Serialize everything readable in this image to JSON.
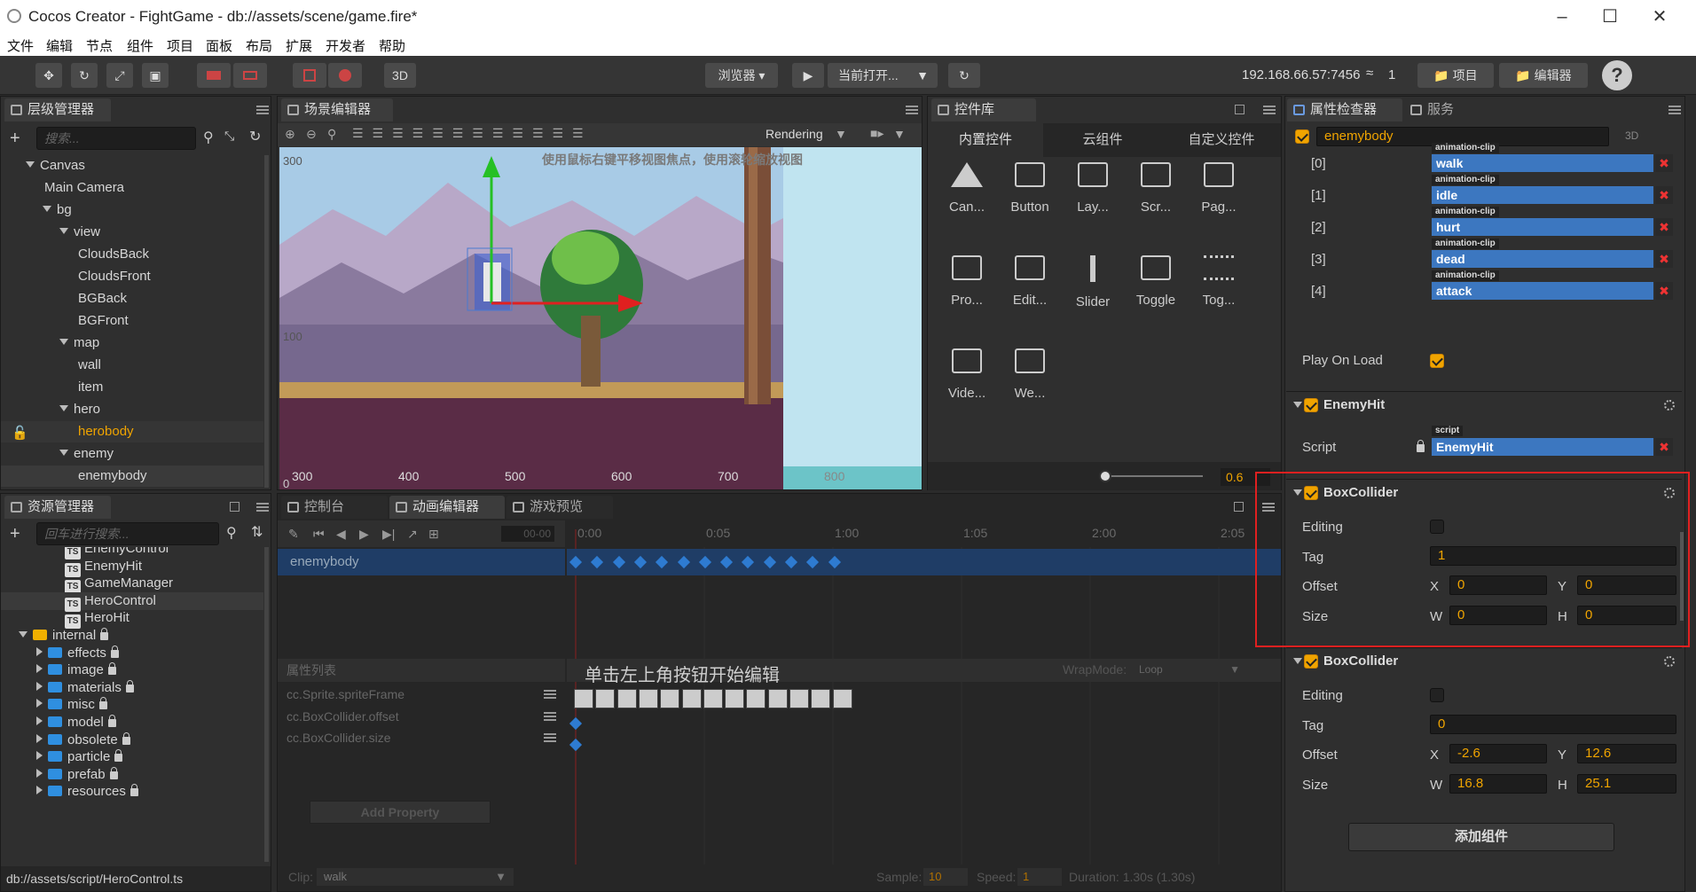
{
  "app": {
    "title": "Cocos Creator - FightGame - db://assets/scene/game.fire*"
  },
  "menu": [
    "文件",
    "编辑",
    "节点",
    "组件",
    "项目",
    "面板",
    "布局",
    "扩展",
    "开发者",
    "帮助"
  ],
  "toolbar": {
    "btn3d": "3D",
    "browser": "浏览器 ▾",
    "current": "当前打开...",
    "ip": "192.168.66.57:7456",
    "conn_count": "1",
    "project": "项目",
    "editor": "编辑器",
    "help": "?"
  },
  "hierarchy": {
    "title": "层级管理器",
    "search_placeholder": "搜索...",
    "nodes": [
      {
        "label": "Canvas",
        "level": 0,
        "arrow": "down"
      },
      {
        "label": "Main Camera",
        "level": 1,
        "arrow": ""
      },
      {
        "label": "bg",
        "level": 1,
        "arrow": "down"
      },
      {
        "label": "view",
        "level": 2,
        "arrow": "down"
      },
      {
        "label": "CloudsBack",
        "level": 3,
        "arrow": ""
      },
      {
        "label": "CloudsFront",
        "level": 3,
        "arrow": ""
      },
      {
        "label": "BGBack",
        "level": 3,
        "arrow": ""
      },
      {
        "label": "BGFront",
        "level": 3,
        "arrow": ""
      },
      {
        "label": "map",
        "level": 2,
        "arrow": "down"
      },
      {
        "label": "wall",
        "level": 3,
        "arrow": ""
      },
      {
        "label": "item",
        "level": 3,
        "arrow": ""
      },
      {
        "label": "hero",
        "level": 2,
        "arrow": "down"
      },
      {
        "label": "herobody",
        "level": 3,
        "arrow": "",
        "highlight": true
      },
      {
        "label": "enemy",
        "level": 2,
        "arrow": "down"
      },
      {
        "label": "enemybody",
        "level": 3,
        "arrow": "",
        "selected": true
      }
    ]
  },
  "scene": {
    "title": "场景编辑器",
    "rendering": "Rendering",
    "hint": "使用鼠标右键平移视图焦点，使用滚轮缩放视图",
    "y_labels": [
      "300",
      "100",
      "0"
    ],
    "x_labels": [
      "300",
      "400",
      "500",
      "600",
      "700",
      "800"
    ]
  },
  "widgets": {
    "title": "控件库",
    "tabs": [
      "内置控件",
      "云组件",
      "自定义控件"
    ],
    "items": [
      {
        "label": "Can...",
        "icon": "canvas-icon"
      },
      {
        "label": "Button",
        "icon": "button-icon"
      },
      {
        "label": "Lay...",
        "icon": "layout-icon"
      },
      {
        "label": "Scr...",
        "icon": "scrollview-icon"
      },
      {
        "label": "Pag...",
        "icon": "pageview-icon"
      },
      {
        "label": "Pro...",
        "icon": "progressbar-icon"
      },
      {
        "label": "Edit...",
        "icon": "editbox-icon"
      },
      {
        "label": "Slider",
        "icon": "slider-icon"
      },
      {
        "label": "Toggle",
        "icon": "toggle-icon"
      },
      {
        "label": "Tog...",
        "icon": "togglegroup-icon"
      },
      {
        "label": "Vide...",
        "icon": "videoplayer-icon"
      },
      {
        "label": "We...",
        "icon": "webview-icon"
      }
    ],
    "zoom": "0.6",
    "zoom_level": 0.0
  },
  "assets": {
    "title": "资源管理器",
    "search_placeholder": "回车进行搜索...",
    "items": [
      {
        "label": "EnemyControl",
        "type": "ts",
        "level": 3
      },
      {
        "label": "EnemyHit",
        "type": "ts",
        "level": 3
      },
      {
        "label": "GameManager",
        "type": "ts",
        "level": 3
      },
      {
        "label": "HeroControl",
        "type": "ts",
        "level": 3,
        "selected": true
      },
      {
        "label": "HeroHit",
        "type": "ts",
        "level": 3
      },
      {
        "label": "internal",
        "type": "db",
        "level": 0,
        "lock": true
      },
      {
        "label": "effects",
        "type": "folder",
        "level": 1,
        "lock": true
      },
      {
        "label": "image",
        "type": "folder",
        "level": 1,
        "lock": true
      },
      {
        "label": "materials",
        "type": "folder",
        "level": 1,
        "lock": true
      },
      {
        "label": "misc",
        "type": "folder",
        "level": 1,
        "lock": true
      },
      {
        "label": "model",
        "type": "folder",
        "level": 1,
        "lock": true
      },
      {
        "label": "obsolete",
        "type": "folder",
        "level": 1,
        "lock": true
      },
      {
        "label": "particle",
        "type": "folder",
        "level": 1,
        "lock": true
      },
      {
        "label": "prefab",
        "type": "folder",
        "level": 1,
        "lock": true
      },
      {
        "label": "resources",
        "type": "folder",
        "level": 1,
        "lock": true
      }
    ],
    "status": "db://assets/script/HeroControl.ts"
  },
  "anim": {
    "tabs": [
      "控制台",
      "动画编辑器",
      "游戏预览"
    ],
    "time": "00-00",
    "node": "enemybody",
    "ticks": [
      "0:00",
      "0:05",
      "1:00",
      "1:05",
      "2:00",
      "2:05"
    ],
    "center_hint": "单击左上角按钮开始编辑",
    "props_title": "属性列表",
    "wrapmode_label": "WrapMode:",
    "wrapmode": "Loop",
    "props": [
      "cc.Sprite.spriteFrame",
      "cc.BoxCollider.offset",
      "cc.BoxCollider.size"
    ],
    "add_property": "Add Property",
    "clip_label": "Clip:",
    "clip": "walk",
    "sample_label": "Sample:",
    "sample": "10",
    "speed_label": "Speed:",
    "speed": "1",
    "duration": "Duration: 1.30s (1.30s)"
  },
  "inspector": {
    "tabs": [
      "属性检查器",
      "服务"
    ],
    "node_name": "enemybody",
    "mode3d": "3D",
    "clips": [
      {
        "index": "[0]",
        "type": "animation-clip",
        "name": "walk"
      },
      {
        "index": "[1]",
        "type": "animation-clip",
        "name": "idle"
      },
      {
        "index": "[2]",
        "type": "animation-clip",
        "name": "hurt"
      },
      {
        "index": "[3]",
        "type": "animation-clip",
        "name": "dead"
      },
      {
        "index": "[4]",
        "type": "animation-clip",
        "name": "attack"
      }
    ],
    "play_on_load": "Play On Load",
    "enemyhit": {
      "title": "EnemyHit",
      "script_label": "Script",
      "script_type": "script",
      "script": "EnemyHit"
    },
    "collider1": {
      "title": "BoxCollider",
      "editing": "Editing",
      "tag_label": "Tag",
      "tag": "1",
      "offset_label": "Offset",
      "ox": "0",
      "oy": "0",
      "size_label": "Size",
      "w": "0",
      "h": "0"
    },
    "collider2": {
      "title": "BoxCollider",
      "editing": "Editing",
      "tag_label": "Tag",
      "tag": "0",
      "offset_label": "Offset",
      "ox": "-2.6",
      "oy": "12.6",
      "size_label": "Size",
      "w": "16.8",
      "h": "25.1"
    },
    "x": "X",
    "y": "Y",
    "wl": "W",
    "hl": "H",
    "add_component": "添加组件"
  },
  "colors": {
    "accent": "#f0a400",
    "selection": "#3c77c0",
    "highlight_box": "#e02020"
  }
}
